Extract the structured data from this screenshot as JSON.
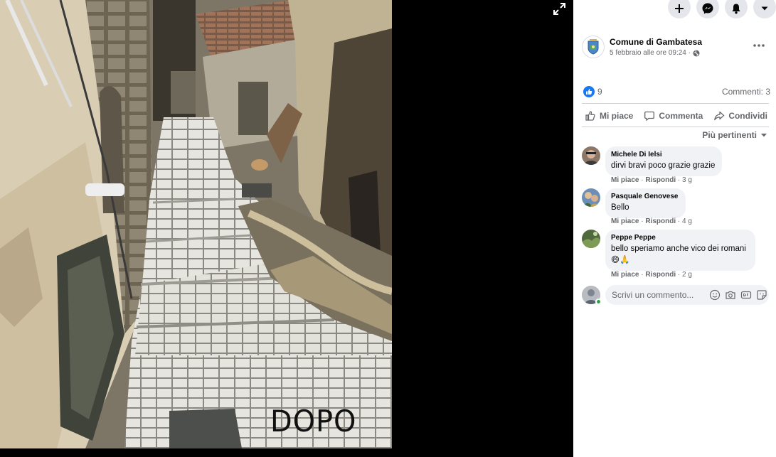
{
  "viewer": {
    "photo_caption": "DOPO",
    "expand_icon": "expand-icon"
  },
  "top_actions": [
    {
      "name": "create-button",
      "icon": "plus-icon"
    },
    {
      "name": "messenger-button",
      "icon": "messenger-icon"
    },
    {
      "name": "notifications-button",
      "icon": "bell-icon"
    },
    {
      "name": "account-menu-button",
      "icon": "caret-down-icon"
    }
  ],
  "post": {
    "page_name": "Comune di Gambatesa",
    "date": "5 febbraio alle ore 09:24 ·",
    "privacy_icon": "globe-icon",
    "reaction_count": "9",
    "comment_count": "Commenti: 3"
  },
  "actions": {
    "like_label": "Mi piace",
    "comment_label": "Commenta",
    "share_label": "Condividi"
  },
  "sort": {
    "label": "Più pertinenti"
  },
  "comments": [
    {
      "author": "Michele Di Ielsi",
      "text": "dirvi bravi poco grazie grazie",
      "like": "Mi piace",
      "reply": "Rispondi",
      "time": "3 g"
    },
    {
      "author": "Pasquale Genovese",
      "text": "Bello",
      "like": "Mi piace",
      "reply": "Rispondi",
      "time": "4 g"
    },
    {
      "author": "Peppe Peppe",
      "text": "bello speriamo anche vico dei romani 😄🙏",
      "like": "Mi piace",
      "reply": "Rispondi",
      "time": "2 g"
    }
  ],
  "write_comment": {
    "placeholder": "Scrivi un commento..."
  },
  "colors": {
    "facebook_blue": "#1877f2",
    "secondary_text": "#65676b",
    "bubble_bg": "#f0f2f5",
    "online_green": "#31a24c"
  }
}
